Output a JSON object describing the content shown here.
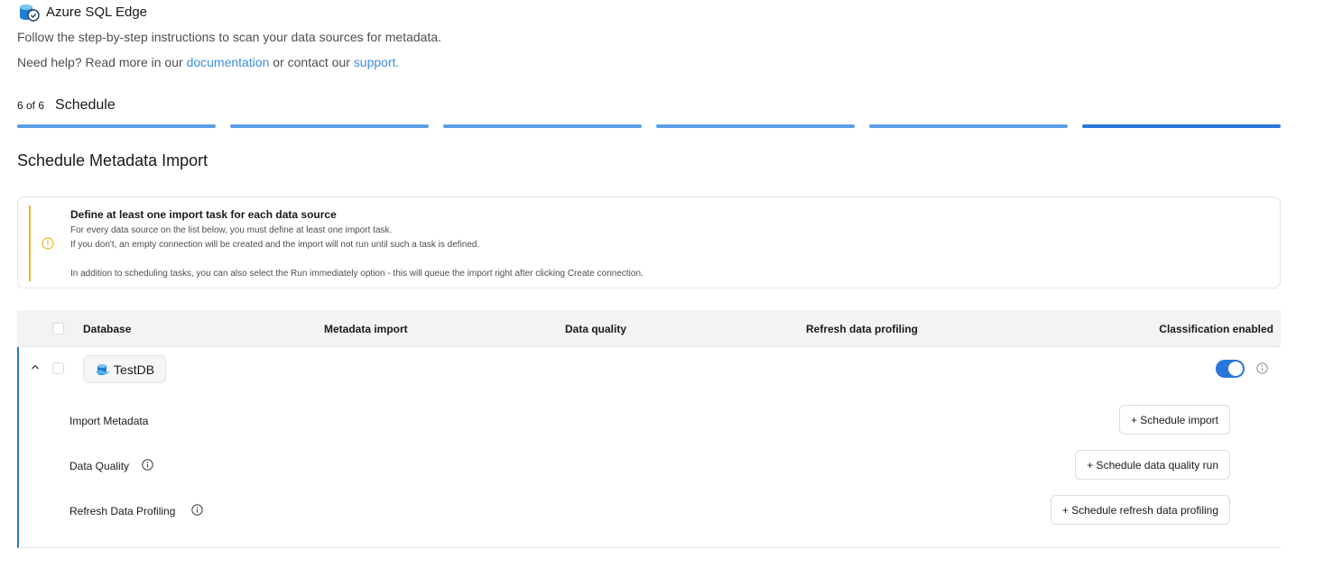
{
  "header": {
    "title": "Azure SQL Edge",
    "icon": "azure-sql-edge-icon",
    "subtitle": "Follow the step-by-step instructions to scan your data sources for metadata.",
    "help_prefix": "Need help? Read more in our",
    "help_doc_link": "documentation",
    "help_middle": "or contact our",
    "help_support_link": "support."
  },
  "wizard": {
    "step_count": "6 of 6",
    "step_name": "Schedule",
    "total_steps": 6,
    "current_step": 6,
    "colors": {
      "done": "#5b9ee6",
      "active": "#2b76db"
    }
  },
  "section": {
    "title": "Schedule Metadata Import"
  },
  "alert": {
    "icon": "warning-circle-icon",
    "accent": "#f0b429",
    "title": "Define at least one import task for each data source",
    "line1": "For every data source on the list below, you must define at least one import task.",
    "line2": "If you don't, an empty connection will be created and the import will not run until such a task is defined.",
    "line3": "In addition to scheduling tasks, you can also select the Run immediately option - this will queue the import right after clicking Create connection."
  },
  "table": {
    "columns": {
      "database": "Database",
      "metadata_import": "Metadata import",
      "data_quality": "Data quality",
      "refresh_profiling": "Refresh data profiling",
      "classification": "Classification enabled"
    },
    "row": {
      "database_name": "TestDB",
      "expanded": true,
      "classification_enabled": true,
      "tasks": [
        {
          "label": "Import Metadata",
          "button": "+ Schedule import",
          "has_info": false
        },
        {
          "label": "Data Quality",
          "button": "+ Schedule data quality run",
          "has_info": true
        },
        {
          "label": "Refresh Data Profiling",
          "button": "+ Schedule refresh data profiling",
          "has_info": true
        }
      ]
    }
  }
}
